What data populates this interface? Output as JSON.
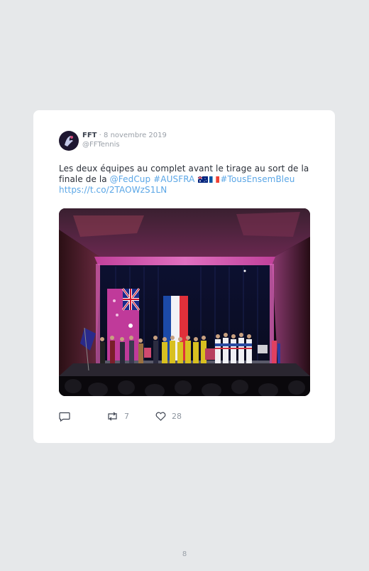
{
  "tweet": {
    "author_name": "FFT",
    "separator": "·",
    "date": "8 novembre 2019",
    "handle": "@FFTennis",
    "text_part1": "Les deux équipes au complet avant le tirage au sort de la finale de la ",
    "mention": "@FedCup",
    "space1": " ",
    "hashtag1": "#AUSFRA",
    "hashtag2": "#TousEnsemBleu",
    "url": "https://t.co/2TAOWzS1LN",
    "flag_icons": [
      "australia-flag-icon",
      "france-flag-icon"
    ],
    "link_color": "#5aa6e6"
  },
  "actions": {
    "reply_icon": "reply-icon",
    "retweet_icon": "retweet-icon",
    "retweet_count": "7",
    "like_icon": "heart-icon",
    "like_count": "28"
  },
  "page": {
    "number": "8"
  }
}
